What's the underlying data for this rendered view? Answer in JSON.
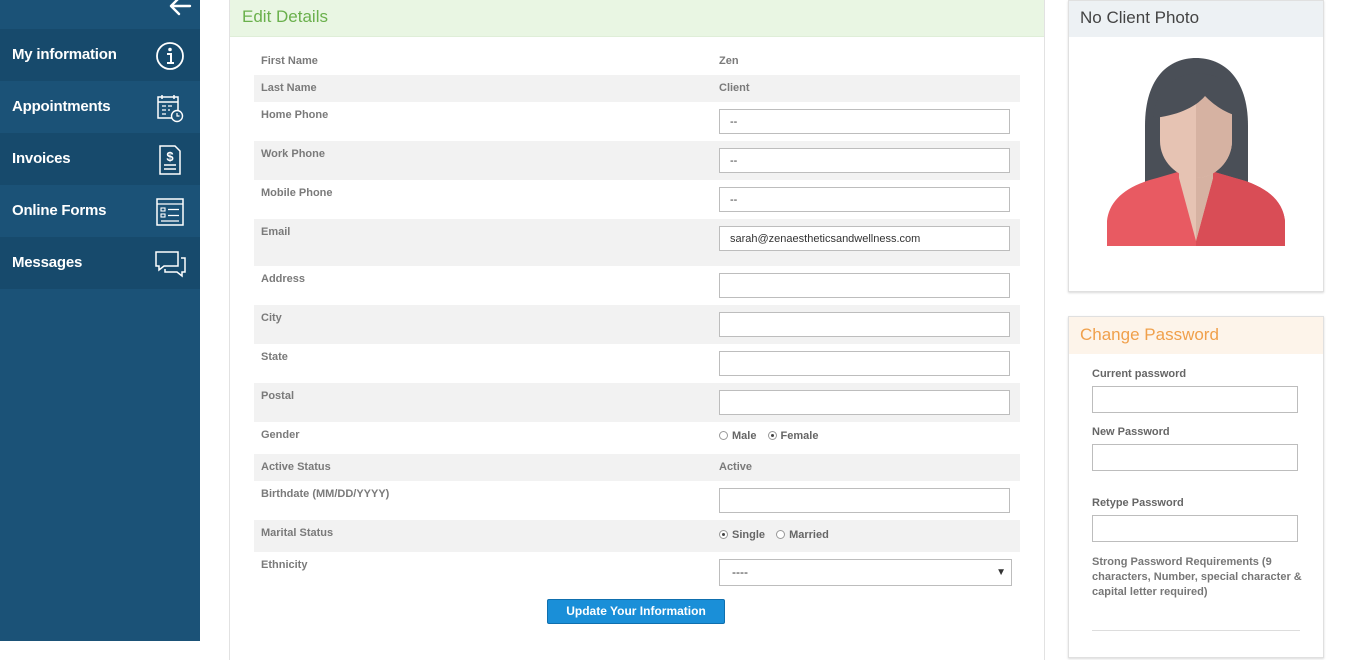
{
  "sidebar": {
    "back_icon": "arrow-left-icon",
    "items": [
      {
        "label": "My information",
        "icon": "info-icon"
      },
      {
        "label": "Appointments",
        "icon": "calendar-clock-icon"
      },
      {
        "label": "Invoices",
        "icon": "invoice-dollar-icon"
      },
      {
        "label": "Online Forms",
        "icon": "form-icon"
      },
      {
        "label": "Messages",
        "icon": "chat-bubbles-icon"
      }
    ]
  },
  "edit_details": {
    "title": "Edit Details",
    "first_name": {
      "label": "First Name",
      "value": "Zen"
    },
    "last_name": {
      "label": "Last Name",
      "value": "Client"
    },
    "home_phone": {
      "label": "Home Phone",
      "value": "--"
    },
    "work_phone": {
      "label": "Work Phone",
      "value": "--"
    },
    "mobile_phone": {
      "label": "Mobile Phone",
      "value": "--"
    },
    "email": {
      "label": "Email",
      "value": "sarah@zenaestheticsandwellness.com"
    },
    "address": {
      "label": "Address",
      "value": ""
    },
    "city": {
      "label": "City",
      "value": ""
    },
    "state": {
      "label": "State",
      "value": ""
    },
    "postal": {
      "label": "Postal",
      "value": ""
    },
    "gender": {
      "label": "Gender",
      "options": [
        "Male",
        "Female"
      ],
      "selected": "Female"
    },
    "active_status": {
      "label": "Active Status",
      "value": "Active"
    },
    "birthdate": {
      "label": "Birthdate (MM/DD/YYYY)",
      "value": ""
    },
    "marital_status": {
      "label": "Marital Status",
      "options": [
        "Single",
        "Married"
      ],
      "selected": "Single"
    },
    "ethnicity": {
      "label": "Ethnicity",
      "value": "----"
    },
    "update_button": "Update Your Information"
  },
  "photo": {
    "title": "No Client Photo"
  },
  "change_password": {
    "title": "Change Password",
    "current_label": "Current password",
    "new_label": "New Password",
    "retype_label": "Retype Password",
    "requirements": "Strong Password Requirements (9 characters, Number, special character & capital letter required)"
  },
  "colors": {
    "sidebar": "#1b5277",
    "details_header": "#6ab04c",
    "password_header": "#f0a04b",
    "button": "#1a8fd8"
  }
}
